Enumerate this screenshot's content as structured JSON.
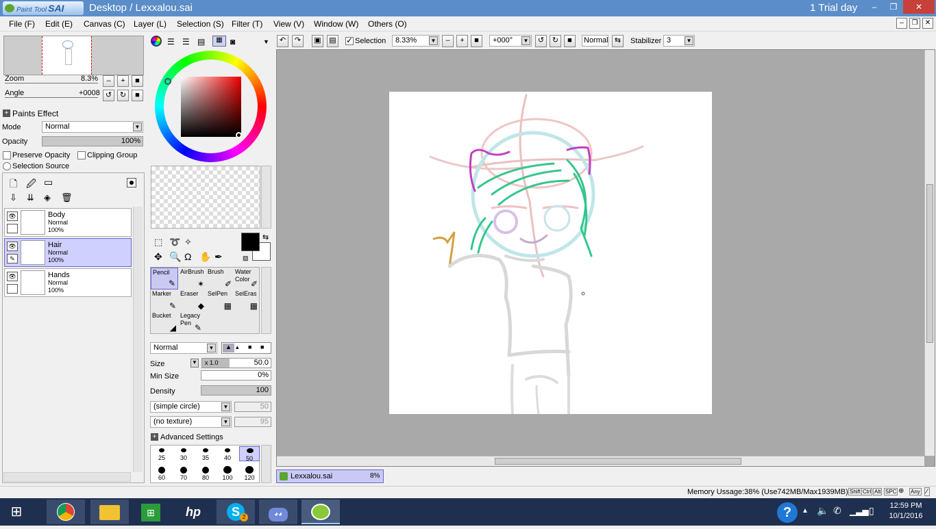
{
  "window": {
    "logo_text": "Paint Tool",
    "logo_brand": "SAI",
    "title": "Desktop / Lexxalou.sai",
    "trial": "1 Trial day",
    "min": "–",
    "restore": "❐",
    "close": "✕"
  },
  "menu": [
    "File (F)",
    "Edit (E)",
    "Canvas (C)",
    "Layer (L)",
    "Selection (S)",
    "Filter (T)",
    "View (V)",
    "Window (W)",
    "Others (O)"
  ],
  "nav": {
    "zoom_label": "Zoom",
    "zoom_value": "8.3%",
    "angle_label": "Angle",
    "angle_value": "+0008"
  },
  "paints_effect": {
    "header": "Paints Effect",
    "mode_label": "Mode",
    "mode_value": "Normal",
    "opacity_label": "Opacity",
    "opacity_value": "100%",
    "preserve_opacity": "Preserve Opacity",
    "clipping_group": "Clipping Group",
    "selection_source": "Selection Source"
  },
  "layers": [
    {
      "name": "Body",
      "mode": "Normal",
      "opacity": "100%",
      "selected": false
    },
    {
      "name": "Hair",
      "mode": "Normal",
      "opacity": "100%",
      "selected": true
    },
    {
      "name": "Hands",
      "mode": "Normal",
      "opacity": "100%",
      "selected": false
    }
  ],
  "tools": [
    {
      "label": "Pencil",
      "icon": "✎",
      "selected": true
    },
    {
      "label": "AirBrush",
      "icon": "✶",
      "selected": false
    },
    {
      "label": "Brush",
      "icon": "✐",
      "selected": false
    },
    {
      "label": "Water Color",
      "icon": "✐",
      "selected": false
    },
    {
      "label": "Marker",
      "icon": "✎",
      "selected": false
    },
    {
      "label": "Eraser",
      "icon": "◆",
      "selected": false
    },
    {
      "label": "SelPen",
      "icon": "▦",
      "selected": false
    },
    {
      "label": "SelEras",
      "icon": "▦",
      "selected": false
    },
    {
      "label": "Bucket",
      "icon": "◢",
      "selected": false
    },
    {
      "label": "Legacy Pen",
      "icon": "✎",
      "selected": false
    }
  ],
  "brush": {
    "mode": "Normal",
    "size_label": "Size",
    "size_mult": "x 1.0",
    "size_value": "50.0",
    "min_size_label": "Min Size",
    "min_size_value": "0%",
    "density_label": "Density",
    "density_value": "100",
    "shape": "(simple circle)",
    "shape_val": "50",
    "texture": "(no texture)",
    "texture_val": "95",
    "advanced": "Advanced Settings",
    "sizes_row1": [
      "25",
      "30",
      "35",
      "40",
      "50"
    ],
    "sizes_row2": [
      "60",
      "70",
      "80",
      "100",
      "120"
    ],
    "selected_size": "50"
  },
  "toolbar": {
    "selection_label": "Selection",
    "zoom": "8.33%",
    "angle": "+000°",
    "blend": "Normal",
    "stabilizer_label": "Stabilizer",
    "stabilizer_value": "3"
  },
  "document_tab": {
    "name": "Lexxalou.sai",
    "zoom": "8%"
  },
  "status": {
    "memory": "Memory Ussage:38% (Use742MB/Max1939MB)",
    "keys": [
      "Shift",
      "Ctrl",
      "Alt",
      "SPC",
      "⊕",
      "Any",
      "∕"
    ]
  },
  "taskbar": {
    "time": "12:59 PM",
    "date": "10/1/2016",
    "skype_badge": "2",
    "apps": [
      "chrome-icon",
      "explorer-icon",
      "store-icon",
      "hp-icon",
      "skype-icon",
      "discord-icon",
      "sai-icon"
    ]
  },
  "colors": {
    "accent": "#5b8dc8",
    "selected_layer": "#d0d0ff",
    "canvas_bg": "#a9a9a9",
    "taskbar": "#1f2f4f"
  }
}
